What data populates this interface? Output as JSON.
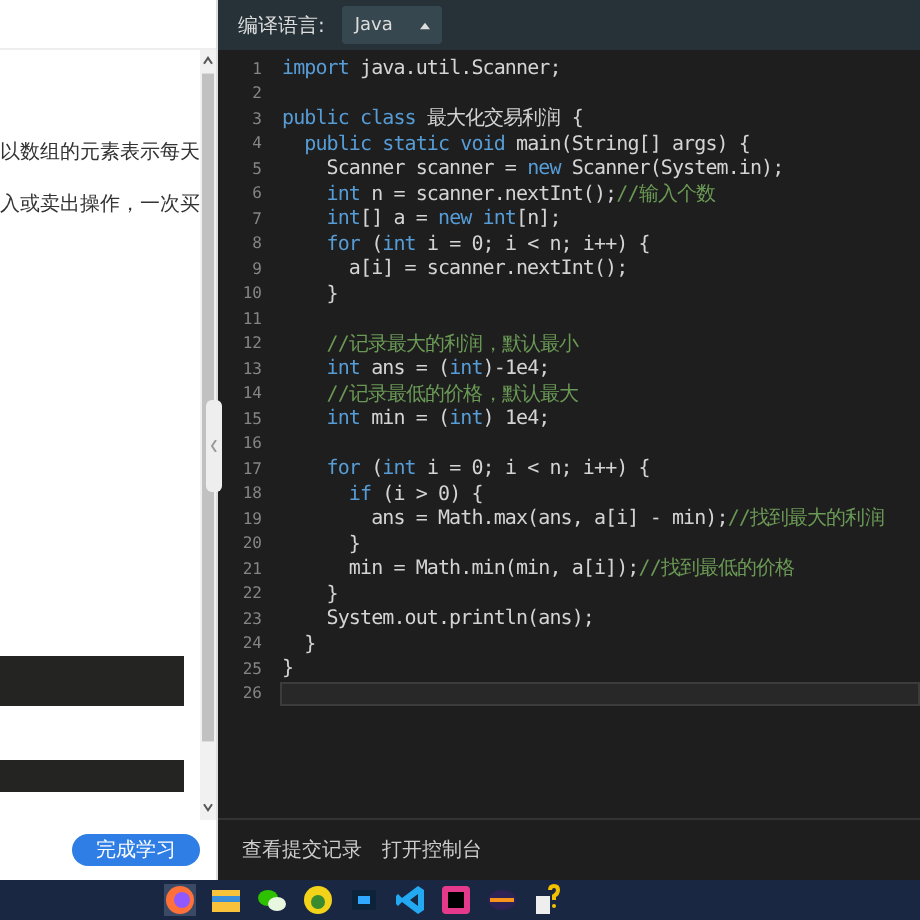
{
  "problem_panel": {
    "text_lines": [
      "以数组的元素表示每天",
      "入或卖出操作，一次买"
    ],
    "finish_button": "完成学习"
  },
  "editor": {
    "language_label": "编译语言:",
    "language": "Java",
    "lines": [
      {
        "number": "1",
        "active": false,
        "segments": [
          {
            "kind": "kw",
            "text": "import"
          },
          {
            "kind": "text",
            "text": " java.util.Scanner;"
          }
        ]
      },
      {
        "number": "2",
        "active": false
      },
      {
        "number": "3",
        "active": false,
        "segments": [
          {
            "kind": "kw",
            "text": "public class"
          },
          {
            "kind": "text",
            "text": " 最大化交易利润 {"
          }
        ]
      },
      {
        "number": "4",
        "active": false,
        "segments": [
          {
            "kind": "kw",
            "text": "  public static void"
          },
          {
            "kind": "text",
            "text": " main(String[] args) {"
          }
        ]
      },
      {
        "number": "5",
        "active": false,
        "segments": [
          {
            "kind": "text",
            "text": "    Scanner scanner = "
          },
          {
            "kind": "kw",
            "text": "new"
          },
          {
            "kind": "text",
            "text": " Scanner(System.in);"
          }
        ]
      },
      {
        "number": "6",
        "active": false,
        "segments": [
          {
            "kind": "kw",
            "text": "    int"
          },
          {
            "kind": "text",
            "text": " n = scanner.nextInt();"
          },
          {
            "kind": "comment",
            "text": "//输入个数"
          }
        ]
      },
      {
        "number": "7",
        "active": false,
        "segments": [
          {
            "kind": "kw",
            "text": "    int"
          },
          {
            "kind": "text",
            "text": "[] a = "
          },
          {
            "kind": "kw",
            "text": "new int"
          },
          {
            "kind": "text",
            "text": "[n];"
          }
        ]
      },
      {
        "number": "8",
        "active": false,
        "segments": [
          {
            "kind": "kw",
            "text": "    for"
          },
          {
            "kind": "text",
            "text": " ("
          },
          {
            "kind": "kw",
            "text": "int"
          },
          {
            "kind": "text",
            "text": " i = 0; i < n; i++) {"
          }
        ]
      },
      {
        "number": "9",
        "active": false,
        "segments": [
          {
            "kind": "text",
            "text": "      a[i] = scanner.nextInt();"
          }
        ]
      },
      {
        "number": "10",
        "active": false,
        "segments": [
          {
            "kind": "text",
            "text": "    }"
          }
        ]
      },
      {
        "number": "11",
        "active": false
      },
      {
        "number": "12",
        "active": false,
        "segments": [
          {
            "kind": "comment",
            "text": "    //记录最大的利润，默认最小"
          }
        ]
      },
      {
        "number": "13",
        "active": false,
        "segments": [
          {
            "kind": "kw",
            "text": "    int"
          },
          {
            "kind": "text",
            "text": " ans = ("
          },
          {
            "kind": "kw",
            "text": "int"
          },
          {
            "kind": "text",
            "text": ")-1e4;"
          }
        ]
      },
      {
        "number": "14",
        "active": false,
        "segments": [
          {
            "kind": "comment",
            "text": "    //记录最低的价格，默认最大"
          }
        ]
      },
      {
        "number": "15",
        "active": false,
        "segments": [
          {
            "kind": "kw",
            "text": "    int"
          },
          {
            "kind": "text",
            "text": " min = ("
          },
          {
            "kind": "kw",
            "text": "int"
          },
          {
            "kind": "text",
            "text": ") 1e4;"
          }
        ]
      },
      {
        "number": "16",
        "active": false
      },
      {
        "number": "17",
        "active": false,
        "segments": [
          {
            "kind": "kw",
            "text": "    for"
          },
          {
            "kind": "text",
            "text": " ("
          },
          {
            "kind": "kw",
            "text": "int"
          },
          {
            "kind": "text",
            "text": " i = 0; i < n; i++) {"
          }
        ]
      },
      {
        "number": "18",
        "active": false,
        "segments": [
          {
            "kind": "kw",
            "text": "      if"
          },
          {
            "kind": "text",
            "text": " (i > 0) {"
          }
        ]
      },
      {
        "number": "19",
        "active": false,
        "segments": [
          {
            "kind": "text",
            "text": "        ans = Math.max(ans, a[i] - min);"
          },
          {
            "kind": "comment",
            "text": "//找到最大的利润"
          }
        ]
      },
      {
        "number": "20",
        "active": false,
        "segments": [
          {
            "kind": "text",
            "text": "      }"
          }
        ]
      },
      {
        "number": "21",
        "active": false,
        "segments": [
          {
            "kind": "text",
            "text": "      min = Math.min(min, a[i]);"
          },
          {
            "kind": "comment",
            "text": "//找到最低的价格"
          }
        ]
      },
      {
        "number": "22",
        "active": false,
        "segments": [
          {
            "kind": "text",
            "text": "    }"
          }
        ]
      },
      {
        "number": "23",
        "active": false,
        "segments": [
          {
            "kind": "text",
            "text": "    System.out.println(ans);"
          }
        ]
      },
      {
        "number": "24",
        "active": false,
        "segments": [
          {
            "kind": "text",
            "text": "  }"
          }
        ]
      },
      {
        "number": "25",
        "active": false,
        "segments": [
          {
            "kind": "text",
            "text": "}"
          }
        ]
      },
      {
        "number": "26",
        "active": true
      }
    ]
  },
  "footer": {
    "links": [
      "查看提交记录",
      "打开控制台"
    ]
  }
}
